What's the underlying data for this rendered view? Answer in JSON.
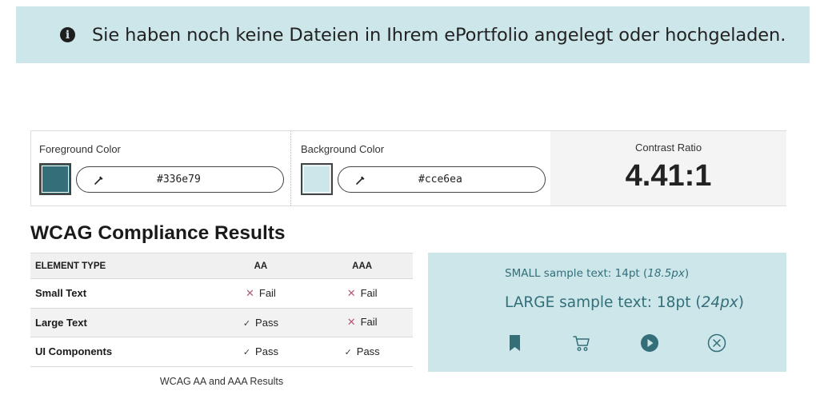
{
  "banner": {
    "icon": "info-circle-icon",
    "message": "Sie haben noch keine Dateien in Ihrem ePortfolio angelegt oder hochgeladen."
  },
  "checker": {
    "foreground": {
      "label": "Foreground Color",
      "hex": "#336e79",
      "color": "#336e79",
      "picker_icon": "eyedropper-icon"
    },
    "background": {
      "label": "Background Color",
      "hex": "#cce6ea",
      "color": "#cce6ea",
      "picker_icon": "eyedropper-icon"
    },
    "contrast": {
      "label": "Contrast Ratio",
      "value": "4.41:1"
    }
  },
  "results": {
    "title": "WCAG Compliance Results",
    "columns": [
      "ELEMENT TYPE",
      "AA",
      "AAA"
    ],
    "rows": [
      {
        "type": "Small Text",
        "aa": "Fail",
        "aaa": "Fail"
      },
      {
        "type": "Large Text",
        "aa": "Pass",
        "aaa": "Fail"
      },
      {
        "type": "UI Components",
        "aa": "Pass",
        "aaa": "Pass"
      }
    ],
    "caption": "WCAG AA and AAA Results"
  },
  "sample": {
    "small_prefix": "SMALL sample text: 14pt (",
    "small_em": "18.5px",
    "small_suffix": ")",
    "large_prefix": "LARGE sample text: 18pt (",
    "large_em": "24px",
    "large_suffix": ")",
    "icons": [
      "bookmark-icon",
      "cart-icon",
      "play-circle-icon",
      "close-circle-icon"
    ]
  },
  "colors": {
    "fail": "#b3567a",
    "pass": "#3a3a3a",
    "accent": "#336e79",
    "tint": "#cce6ea"
  }
}
